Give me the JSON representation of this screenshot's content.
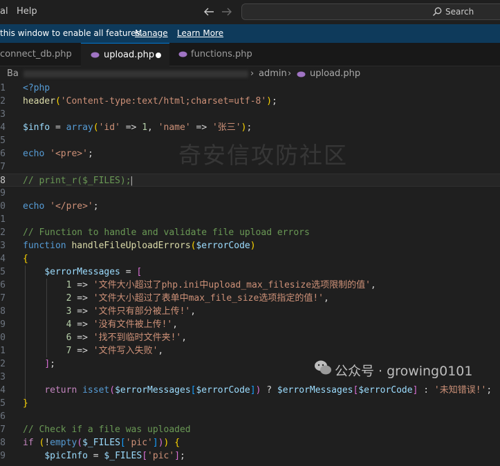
{
  "colors": {
    "keyword": "#569cd6",
    "control": "#c586c0",
    "function": "#dcdcaa",
    "variable": "#9cdcfe",
    "string": "#ce9178",
    "number": "#b5cea8",
    "comment": "#6a9955",
    "bracket1": "#ffd700",
    "bracket2": "#da70d6",
    "bracket3": "#179fff",
    "plain": "#d4d4d4",
    "php_tag": "#569cd6"
  },
  "menubar": {
    "menu_1": "al",
    "menu_2": "Help"
  },
  "nav": {
    "back_icon": "arrow-left-icon",
    "forward_icon": "arrow-right-icon"
  },
  "search": {
    "label": "Search",
    "icon": "search-icon"
  },
  "banner": {
    "text": "this window to enable all features.",
    "manage": "Manage",
    "learn_more": "Learn More"
  },
  "tabs": [
    {
      "label": "connect_db.php",
      "icon": "php-icon"
    },
    {
      "label": "upload.php",
      "icon": "php-icon",
      "active": true,
      "modified": true
    },
    {
      "label": "functions.php",
      "icon": "php-icon"
    }
  ],
  "breadcrumb": {
    "first": "Ba",
    "folder": "admin",
    "file": "upload.php",
    "separator": "›"
  },
  "watermark": {
    "text": "奇安信攻防社区",
    "badge": "公众号 · growing0101",
    "badge_icon": "wechat-icon"
  },
  "editor": {
    "lines": [
      {
        "n": "1",
        "tokens": [
          [
            "<?php",
            "php_tag"
          ]
        ]
      },
      {
        "n": "2",
        "tokens": [
          [
            "header",
            "function"
          ],
          [
            "(",
            "bracket1"
          ],
          [
            "'Content-type:text/html;charset=utf-8'",
            "string"
          ],
          [
            ")",
            "bracket1"
          ],
          [
            ";",
            "plain"
          ]
        ]
      },
      {
        "n": "3",
        "tokens": []
      },
      {
        "n": "4",
        "tokens": [
          [
            "$info",
            "variable"
          ],
          [
            " = ",
            "plain"
          ],
          [
            "array",
            "keyword"
          ],
          [
            "(",
            "bracket1"
          ],
          [
            "'id'",
            "string"
          ],
          [
            " => ",
            "plain"
          ],
          [
            "1",
            "number"
          ],
          [
            ", ",
            "plain"
          ],
          [
            "'name'",
            "string"
          ],
          [
            " => ",
            "plain"
          ],
          [
            "'张三'",
            "string"
          ],
          [
            ")",
            "bracket1"
          ],
          [
            ";",
            "plain"
          ]
        ]
      },
      {
        "n": "5",
        "tokens": []
      },
      {
        "n": "6",
        "tokens": [
          [
            "echo",
            "keyword"
          ],
          [
            " ",
            "plain"
          ],
          [
            "'<pre>'",
            "string"
          ],
          [
            ";",
            "plain"
          ]
        ]
      },
      {
        "n": "7",
        "tokens": []
      },
      {
        "n": "8",
        "current": true,
        "tokens": [
          [
            "// print_r($_FILES);",
            "comment"
          ],
          [
            "|",
            "plain"
          ]
        ]
      },
      {
        "n": "9",
        "tokens": []
      },
      {
        "n": "0",
        "tokens": [
          [
            "echo",
            "keyword"
          ],
          [
            " ",
            "plain"
          ],
          [
            "'</pre>'",
            "string"
          ],
          [
            ";",
            "plain"
          ]
        ]
      },
      {
        "n": "1",
        "tokens": []
      },
      {
        "n": "2",
        "tokens": [
          [
            "// Function to handle and validate file upload errors",
            "comment"
          ]
        ]
      },
      {
        "n": "3",
        "tokens": [
          [
            "function",
            "keyword"
          ],
          [
            " ",
            "plain"
          ],
          [
            "handleFileUploadErrors",
            "function"
          ],
          [
            "(",
            "bracket1"
          ],
          [
            "$errorCode",
            "variable"
          ],
          [
            ")",
            "bracket1"
          ]
        ]
      },
      {
        "n": "4",
        "tokens": [
          [
            "{",
            "bracket1"
          ]
        ]
      },
      {
        "n": "5",
        "tokens": [
          [
            "    ",
            "plain"
          ],
          [
            "$errorMessages",
            "variable"
          ],
          [
            " = ",
            "plain"
          ],
          [
            "[",
            "bracket2"
          ]
        ]
      },
      {
        "n": "6",
        "tokens": [
          [
            "        ",
            "plain"
          ],
          [
            "1",
            "number"
          ],
          [
            " => ",
            "plain"
          ],
          [
            "'文件大小超过了php.ini中upload_max_filesize选项限制的值'",
            "string"
          ],
          [
            ",",
            "plain"
          ]
        ]
      },
      {
        "n": "7",
        "tokens": [
          [
            "        ",
            "plain"
          ],
          [
            "2",
            "number"
          ],
          [
            " => ",
            "plain"
          ],
          [
            "'文件大小超过了表单中max_file_size选项指定的值!'",
            "string"
          ],
          [
            ",",
            "plain"
          ]
        ]
      },
      {
        "n": "8",
        "tokens": [
          [
            "        ",
            "plain"
          ],
          [
            "3",
            "number"
          ],
          [
            " => ",
            "plain"
          ],
          [
            "'文件只有部分被上传!'",
            "string"
          ],
          [
            ",",
            "plain"
          ]
        ]
      },
      {
        "n": "9",
        "tokens": [
          [
            "        ",
            "plain"
          ],
          [
            "4",
            "number"
          ],
          [
            " => ",
            "plain"
          ],
          [
            "'没有文件被上传!'",
            "string"
          ],
          [
            ",",
            "plain"
          ]
        ]
      },
      {
        "n": "0",
        "tokens": [
          [
            "        ",
            "plain"
          ],
          [
            "6",
            "number"
          ],
          [
            " => ",
            "plain"
          ],
          [
            "'找不到临时文件夹!'",
            "string"
          ],
          [
            ",",
            "plain"
          ]
        ]
      },
      {
        "n": "1",
        "tokens": [
          [
            "        ",
            "plain"
          ],
          [
            "7",
            "number"
          ],
          [
            " => ",
            "plain"
          ],
          [
            "'文件写入失败'",
            "string"
          ],
          [
            ",",
            "plain"
          ]
        ]
      },
      {
        "n": "2",
        "tokens": [
          [
            "    ",
            "plain"
          ],
          [
            "]",
            "bracket2"
          ],
          [
            ";",
            "plain"
          ]
        ]
      },
      {
        "n": "3",
        "tokens": []
      },
      {
        "n": "4",
        "tokens": [
          [
            "    ",
            "plain"
          ],
          [
            "return",
            "control"
          ],
          [
            " ",
            "plain"
          ],
          [
            "isset",
            "keyword"
          ],
          [
            "(",
            "bracket2"
          ],
          [
            "$errorMessages",
            "variable"
          ],
          [
            "[",
            "bracket3"
          ],
          [
            "$errorCode",
            "variable"
          ],
          [
            "]",
            "bracket3"
          ],
          [
            ")",
            "bracket2"
          ],
          [
            " ? ",
            "plain"
          ],
          [
            "$errorMessages",
            "variable"
          ],
          [
            "[",
            "bracket2"
          ],
          [
            "$errorCode",
            "variable"
          ],
          [
            "]",
            "bracket2"
          ],
          [
            " : ",
            "plain"
          ],
          [
            "'未知错误!'",
            "string"
          ],
          [
            ";",
            "plain"
          ]
        ]
      },
      {
        "n": "5",
        "tokens": [
          [
            "}",
            "bracket1"
          ]
        ]
      },
      {
        "n": "6",
        "tokens": []
      },
      {
        "n": "7",
        "tokens": [
          [
            "// Check if a file was uploaded",
            "comment"
          ]
        ]
      },
      {
        "n": "8",
        "tokens": [
          [
            "if",
            "control"
          ],
          [
            " ",
            "plain"
          ],
          [
            "(",
            "bracket1"
          ],
          [
            "!",
            "plain"
          ],
          [
            "empty",
            "keyword"
          ],
          [
            "(",
            "bracket2"
          ],
          [
            "$_FILES",
            "variable"
          ],
          [
            "[",
            "bracket3"
          ],
          [
            "'pic'",
            "string"
          ],
          [
            "]",
            "bracket3"
          ],
          [
            ")",
            "bracket2"
          ],
          [
            ")",
            "bracket1"
          ],
          [
            " ",
            "plain"
          ],
          [
            "{",
            "bracket1"
          ]
        ]
      },
      {
        "n": "9",
        "tokens": [
          [
            "    ",
            "plain"
          ],
          [
            "$picInfo",
            "variable"
          ],
          [
            " = ",
            "plain"
          ],
          [
            "$_FILES",
            "variable"
          ],
          [
            "[",
            "bracket2"
          ],
          [
            "'pic'",
            "string"
          ],
          [
            "]",
            "bracket2"
          ],
          [
            ";",
            "plain"
          ]
        ]
      }
    ]
  }
}
